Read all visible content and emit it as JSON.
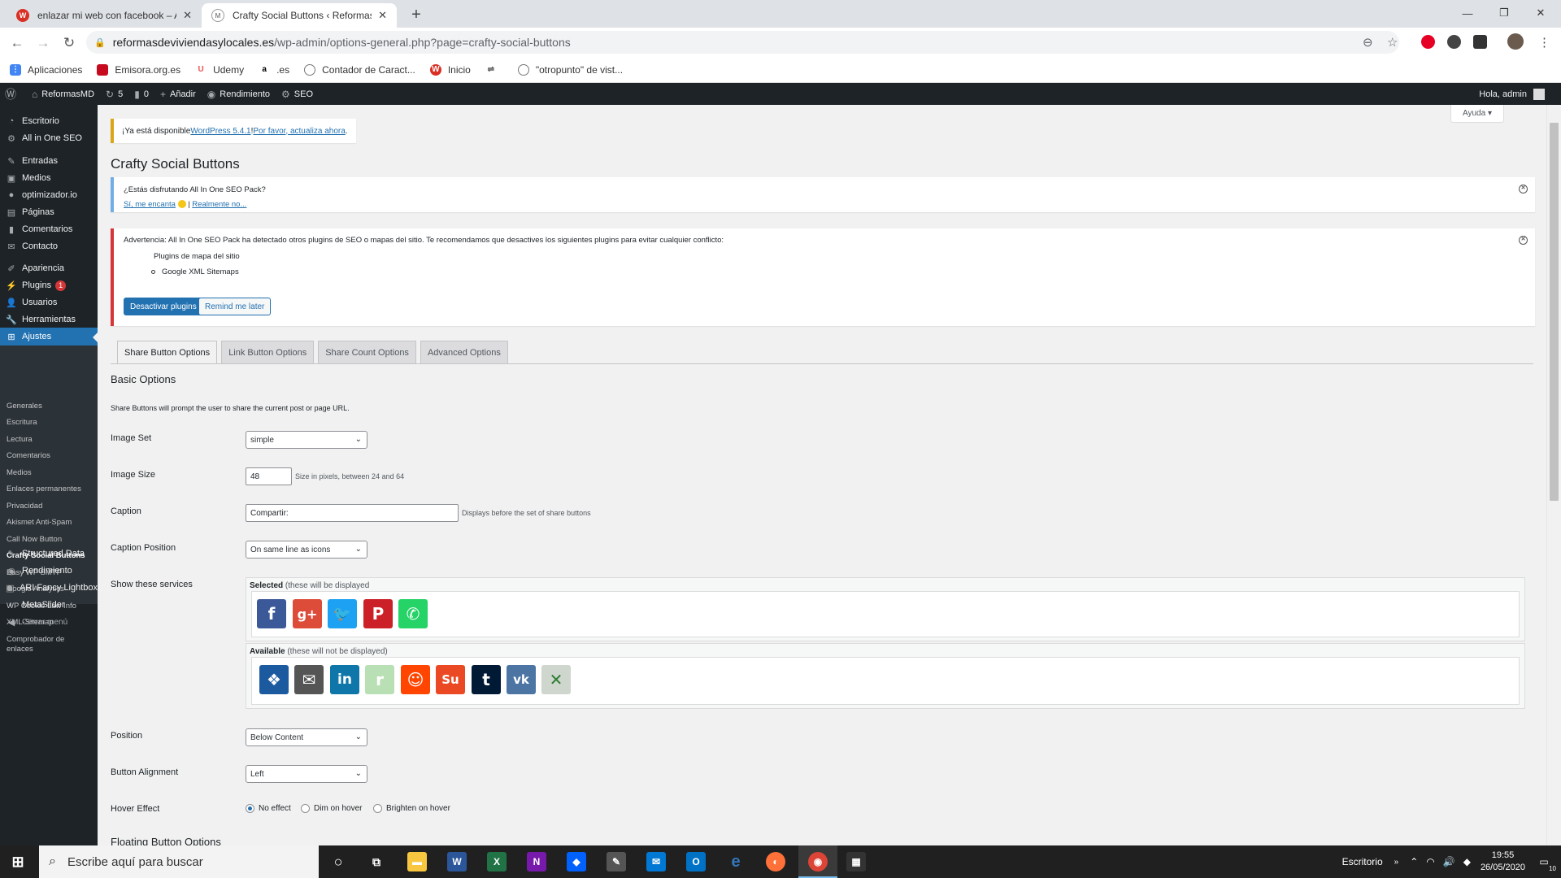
{
  "browser": {
    "tabs": [
      {
        "title": "enlazar mi web con facebook – A",
        "active": false
      },
      {
        "title": "Crafty Social Buttons ‹ Reformas",
        "active": true
      }
    ],
    "url_domain": "reformasdeviviendasylocales.es",
    "url_path": "/wp-admin/options-general.php?page=crafty-social-buttons",
    "bookmarks": [
      "Aplicaciones",
      "Emisora.org.es",
      "Udemy",
      ".es",
      "Contador de Caract...",
      "Inicio",
      "\"otropunto\" de vist..."
    ]
  },
  "adminbar": {
    "site": "ReformasMD",
    "updates": "5",
    "comments": "0",
    "new": "Añadir",
    "performance": "Rendimiento",
    "seo": "SEO",
    "greeting": "Hola, admin"
  },
  "sidebar": {
    "top": [
      {
        "label": "Escritorio"
      },
      {
        "label": "All in One SEO"
      }
    ],
    "mid": [
      {
        "label": "Entradas"
      },
      {
        "label": "Medios"
      },
      {
        "label": "optimizador.io"
      },
      {
        "label": "Páginas"
      },
      {
        "label": "Comentarios"
      },
      {
        "label": "Contacto"
      }
    ],
    "lower": [
      {
        "label": "Apariencia"
      },
      {
        "label": "Plugins",
        "badge": "1"
      },
      {
        "label": "Usuarios"
      },
      {
        "label": "Herramientas"
      },
      {
        "label": "Ajustes"
      }
    ],
    "submenu": [
      "Generales",
      "Escritura",
      "Lectura",
      "Comentarios",
      "Medios",
      "Enlaces permanentes",
      "Privacidad",
      "Akismet Anti-Spam",
      "Call Now Button",
      "Crafty Social Buttons",
      "Easy WP SMTP",
      "Google Analytics",
      "WP Cookie Law Info",
      "XML-Sitemap",
      "Comprobador de",
      "enlaces"
    ],
    "bottom": [
      {
        "label": "Structured Data"
      },
      {
        "label": "Rendimiento"
      },
      {
        "label": "ARI Fancy Lightbox"
      },
      {
        "label": "MetaSlider"
      },
      {
        "label": "Cerrar menú"
      }
    ]
  },
  "help": "Ayuda",
  "update_nag": {
    "pre": "¡Ya está disponible ",
    "link1": "WordPress 5.4.1",
    "mid": "! ",
    "link2": "Por favor, actualiza ahora",
    "post": "."
  },
  "page_title": "Crafty Social Buttons",
  "notice1": {
    "question": "¿Estás disfrutando All In One SEO Pack?",
    "yes": "Sí, me encanta",
    "sep": "|",
    "no": "Realmente no..."
  },
  "notice2": {
    "text": "Advertencia: All In One SEO Pack ha detectado otros plugins de SEO o mapas del sitio. Te recomendamos que desactives los siguientes plugins para evitar cualquier conflicto:",
    "heading": "Plugins de mapa del sitio",
    "item": "Google XML Sitemaps",
    "btn_deactivate": "Desactivar plugins",
    "btn_remind": "Remind me later"
  },
  "tabs": [
    "Share Button Options",
    "Link Button Options",
    "Share Count Options",
    "Advanced Options"
  ],
  "section_title": "Basic Options",
  "section_desc": "Share Buttons will prompt the user to share the current post or page URL.",
  "fields": {
    "image_set": {
      "label": "Image Set",
      "value": "simple"
    },
    "image_size": {
      "label": "Image Size",
      "value": "48",
      "desc": "Size in pixels, between 24 and 64"
    },
    "caption": {
      "label": "Caption",
      "value": "Compartir:",
      "desc": "Displays before the set of share buttons"
    },
    "caption_position": {
      "label": "Caption Position",
      "value": "On same line as icons"
    },
    "services": {
      "label": "Show these services",
      "selected_caption": "Selected",
      "selected_note": " (these will be displayed",
      "available_caption": "Available",
      "available_note": " (these will not be displayed)"
    },
    "position": {
      "label": "Position",
      "value": "Below Content"
    },
    "alignment": {
      "label": "Button Alignment",
      "value": "Left"
    },
    "hover": {
      "label": "Hover Effect",
      "options": [
        "No effect",
        "Dim on hover",
        "Brighten on hover"
      ],
      "selected": 0
    }
  },
  "selected_services": [
    {
      "name": "facebook-icon",
      "glyph": "f",
      "color": "#3b5998"
    },
    {
      "name": "google-plus-icon",
      "glyph": "g+",
      "color": "#dd4b39"
    },
    {
      "name": "twitter-icon",
      "glyph": "🐦",
      "color": "#1da1f2"
    },
    {
      "name": "pinterest-icon",
      "glyph": "P",
      "color": "#cb2027"
    },
    {
      "name": "whatsapp-icon",
      "glyph": "✆",
      "color": "#25d366"
    }
  ],
  "available_services": [
    {
      "name": "digg-icon",
      "glyph": "❖",
      "color": "#1c5aa0"
    },
    {
      "name": "email-icon",
      "glyph": "✉",
      "color": "#555555"
    },
    {
      "name": "linkedin-icon",
      "glyph": "in",
      "color": "#0e76a8"
    },
    {
      "name": "renren-icon",
      "glyph": "r",
      "color": "#b9e0b4"
    },
    {
      "name": "reddit-icon",
      "glyph": "☺",
      "color": "#ff4500"
    },
    {
      "name": "stumbleupon-icon",
      "glyph": "Su",
      "color": "#eb4924"
    },
    {
      "name": "tumblr-icon",
      "glyph": "t",
      "color": "#001935"
    },
    {
      "name": "vk-icon",
      "glyph": "vk",
      "color": "#4c75a3"
    },
    {
      "name": "xing-icon",
      "glyph": "✕",
      "color": "#cfd6ce"
    }
  ],
  "next_section": "Floating Button Options",
  "taskbar": {
    "search_placeholder": "Escribe aquí para buscar",
    "desktop": "Escritorio",
    "time": "19:55",
    "date": "26/05/2020",
    "notif": "10"
  },
  "colors": {
    "wp_blue": "#2271b1",
    "admin_dark": "#1d2327",
    "warning_red": "#d63638",
    "info_blue": "#72aee6",
    "nag_yellow": "#dba617"
  }
}
